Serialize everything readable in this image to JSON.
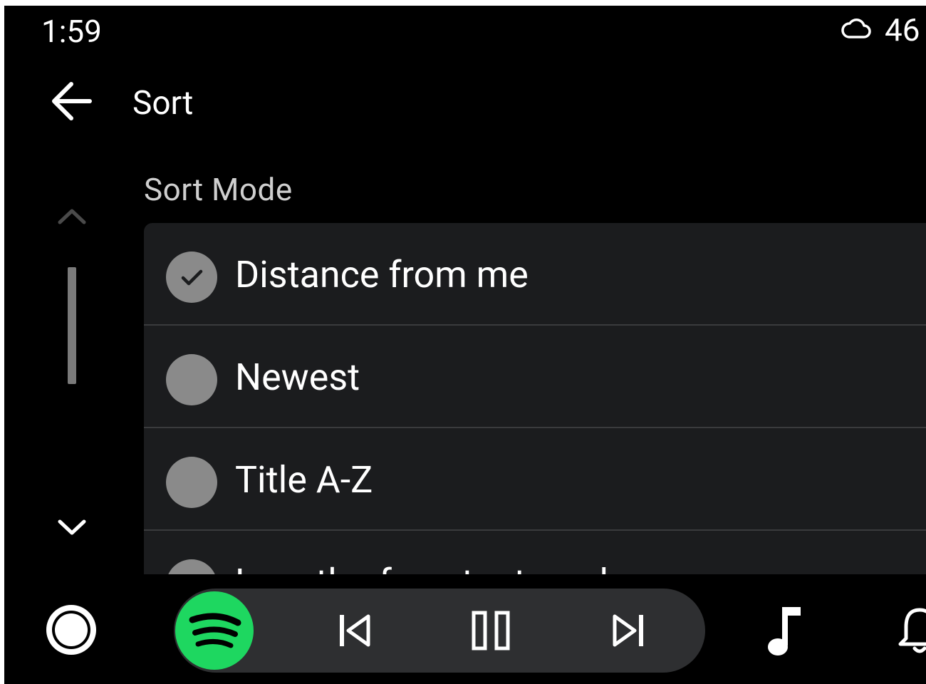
{
  "status_bar": {
    "time": "1:59",
    "weather_icon": "cloud-icon",
    "temperature": "46"
  },
  "header": {
    "back_icon": "arrow-left-icon",
    "title": "Sort"
  },
  "scroll": {
    "up_icon": "chevron-up-icon",
    "down_icon": "chevron-down-icon"
  },
  "section": {
    "title": "Sort Mode"
  },
  "options": [
    {
      "label": "Distance from me",
      "selected": true
    },
    {
      "label": "Newest",
      "selected": false
    },
    {
      "label": "Title A-Z",
      "selected": false
    },
    {
      "label": "Length of content read",
      "selected": false
    }
  ],
  "bottom_bar": {
    "home_icon": "home-circle-icon",
    "app_icon": "spotify-icon",
    "previous_icon": "skip-previous-icon",
    "pause_icon": "pause-icon",
    "next_icon": "skip-next-icon",
    "music_icon": "music-note-icon",
    "notification_icon": "bell-icon"
  },
  "colors": {
    "background": "#000000",
    "card": "#1b1c1e",
    "divider": "#3a3b3d",
    "radio": "#8a8a8a",
    "spotify_green": "#1ed760",
    "pill": "#2e2f31"
  }
}
